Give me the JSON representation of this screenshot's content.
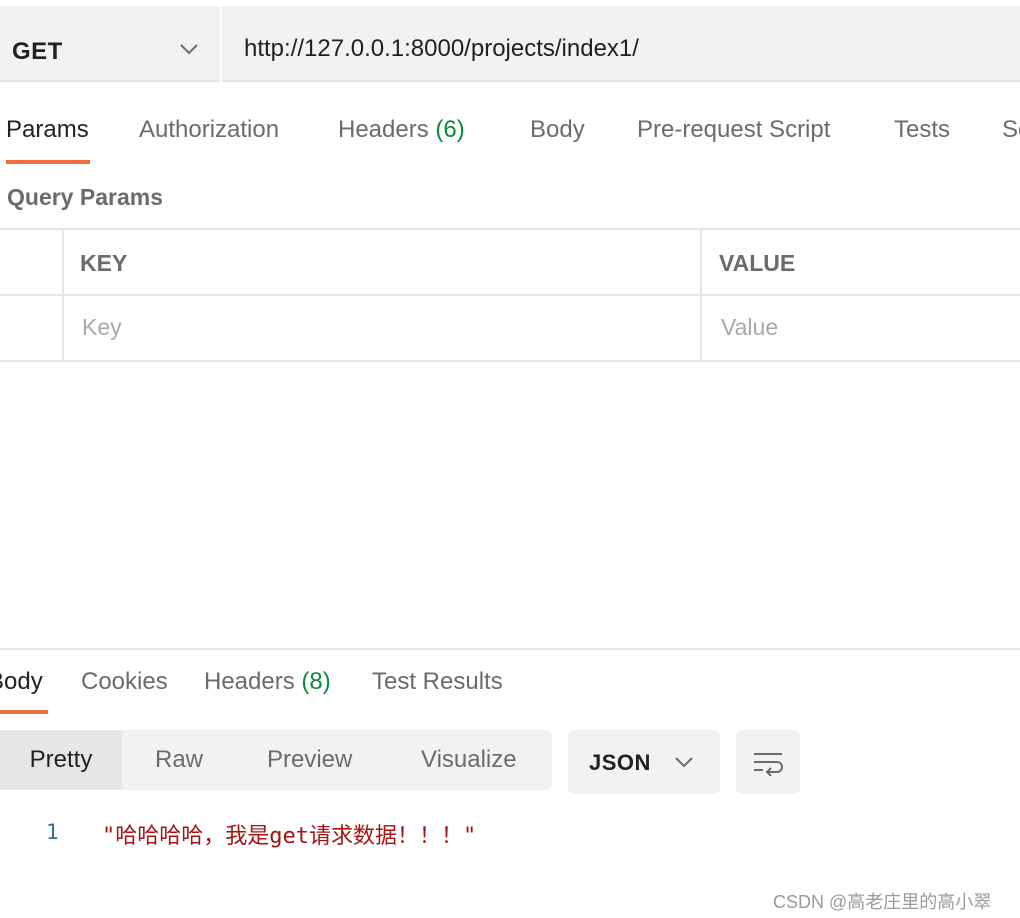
{
  "request": {
    "method": "GET",
    "url": "http://127.0.0.1:8000/projects/index1/"
  },
  "request_tabs": [
    {
      "label": "Params",
      "count": ""
    },
    {
      "label": "Authorization",
      "count": ""
    },
    {
      "label": "Headers",
      "count": "(6)"
    },
    {
      "label": "Body",
      "count": ""
    },
    {
      "label": "Pre-request Script",
      "count": ""
    },
    {
      "label": "Tests",
      "count": ""
    },
    {
      "label": "Se",
      "count": ""
    }
  ],
  "active_request_tab": "Params",
  "query_params": {
    "title": "Query Params",
    "columns": [
      "KEY",
      "VALUE"
    ],
    "placeholders": {
      "key": "Key",
      "value": "Value"
    }
  },
  "response_tabs": [
    {
      "label": "Body",
      "count": ""
    },
    {
      "label": "Cookies",
      "count": ""
    },
    {
      "label": "Headers",
      "count": "(8)"
    },
    {
      "label": "Test Results",
      "count": ""
    }
  ],
  "active_response_tab": "Body",
  "view_modes": [
    "Pretty",
    "Raw",
    "Preview",
    "Visualize"
  ],
  "active_view_mode": "Pretty",
  "format": "JSON",
  "response_body": [
    {
      "line": "1",
      "text": "\"哈哈哈哈，我是get请求数据！！！\""
    }
  ],
  "watermark": "CSDN @高老庄里的高小翠",
  "colors": {
    "accent": "#f26b3a",
    "count": "#0b8a3e",
    "string": "#a31515"
  },
  "icons": {
    "method_dropdown": "chevron-down-icon",
    "format_dropdown": "chevron-down-icon",
    "wrap": "wrap-lines-icon"
  }
}
